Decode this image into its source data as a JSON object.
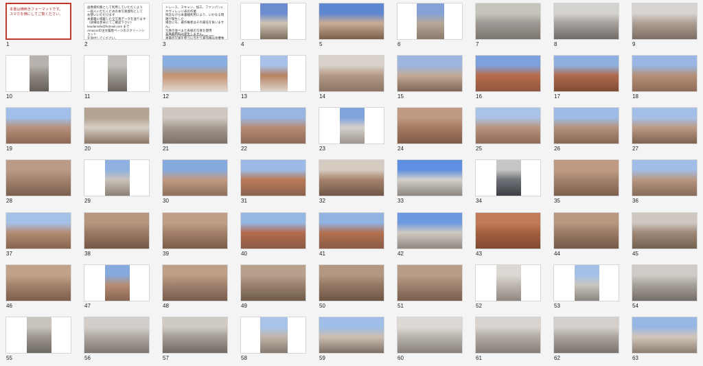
{
  "colors": {
    "background": "#f4f4f4",
    "selection": "#c0392b"
  },
  "pages": [
    {
      "n": "1",
      "kind": "text",
      "text": "本書は横倒きフォーマットです。\nスマホを横にしてご覧ください。"
    },
    {
      "n": "2",
      "kind": "text",
      "text": "画像資料集として利用していただくよう\n一般人いただくための本写真資料として\nお使いいただけます\n本書籍に掲載した全写真データを送ります\n（詳細は巻末にてご確認下さい）\nkaudamafu@hotmail.com まで\nAmazonの注文履歴ページのスクリーンショット\nを添付してください。\n個人撮影の写真ですのでご了承ください。\nTwitterで最新の写真公開"
    },
    {
      "n": "3",
      "kind": "text",
      "text": "トレース、スキャン、加工、ファンパン1\nやヴィレッジ表の作業\n残念ながら本書籍利用により、いかなる問題が発生した\n場合にも、著作権者はその責任を負いません。\n写真の並べまた表紙の写真を使用\n写真使用料は発生しません。\n本書の写真を使うに当たり著作権は放棄致します。\n写真の寿命を延ばすため",
      "footer": "問い合わせ先  kaudamafu@hotmail.com"
    },
    {
      "n": "4",
      "kind": "photo",
      "shape": "portrait2",
      "c": [
        "#6b8ccf",
        "#cfc3b4",
        "#7d6e5f"
      ]
    },
    {
      "n": "5",
      "kind": "photo",
      "shape": "full",
      "c": [
        "#5f86d1",
        "#c9ad95",
        "#7b5d4b"
      ]
    },
    {
      "n": "6",
      "kind": "photo",
      "shape": "portrait2",
      "c": [
        "#84a2d6",
        "#b7a898",
        "#8a7a6c"
      ]
    },
    {
      "n": "7",
      "kind": "photo",
      "shape": "full",
      "c": [
        "#c7c3bd",
        "#9f9a95",
        "#7a746f"
      ]
    },
    {
      "n": "8",
      "kind": "photo",
      "shape": "full",
      "c": [
        "#d4d2cf",
        "#a6a19c",
        "#6f6a65"
      ]
    },
    {
      "n": "9",
      "kind": "photo",
      "shape": "full",
      "c": [
        "#d7d4d1",
        "#ae9f93",
        "#7c6e64"
      ]
    },
    {
      "n": "10",
      "kind": "photo",
      "shape": "portrait3",
      "c": [
        "#b8b3ae",
        "#8f8882",
        "#66605a"
      ]
    },
    {
      "n": "11",
      "kind": "photo",
      "shape": "portrait3",
      "c": [
        "#c3bfbb",
        "#9d9791",
        "#6c655f"
      ]
    },
    {
      "n": "12",
      "kind": "photo",
      "shape": "full",
      "c": [
        "#8aaedf",
        "#c4926f",
        "#e1d7cd"
      ]
    },
    {
      "n": "13",
      "kind": "photo",
      "shape": "portrait2",
      "c": [
        "#a7c1e8",
        "#b88263",
        "#dcd4cb"
      ]
    },
    {
      "n": "14",
      "kind": "photo",
      "shape": "full",
      "c": [
        "#d9d2ca",
        "#b39a87",
        "#8d7464"
      ]
    },
    {
      "n": "15",
      "kind": "photo",
      "shape": "full",
      "c": [
        "#9cb6df",
        "#c2ab98",
        "#7f6656"
      ]
    },
    {
      "n": "16",
      "kind": "photo",
      "shape": "full",
      "c": [
        "#7da1dc",
        "#b86d4a",
        "#8f5840"
      ]
    },
    {
      "n": "17",
      "kind": "photo",
      "shape": "full",
      "c": [
        "#8eb0e0",
        "#b06b4c",
        "#7d4b35"
      ]
    },
    {
      "n": "18",
      "kind": "photo",
      "shape": "full",
      "c": [
        "#97b6e3",
        "#b69077",
        "#8e6b58"
      ]
    },
    {
      "n": "19",
      "kind": "photo",
      "shape": "full",
      "c": [
        "#a1bfe8",
        "#b7917b",
        "#8d6753"
      ]
    },
    {
      "n": "20",
      "kind": "photo",
      "shape": "full",
      "c": [
        "#b4a493",
        "#d6cec6",
        "#8b7564"
      ]
    },
    {
      "n": "21",
      "kind": "photo",
      "shape": "full",
      "c": [
        "#cfc8c1",
        "#a59a91",
        "#7b6f66"
      ]
    },
    {
      "n": "22",
      "kind": "photo",
      "shape": "full",
      "c": [
        "#9ab6e0",
        "#b58b74",
        "#8f6b59"
      ]
    },
    {
      "n": "23",
      "kind": "photo",
      "shape": "portrait",
      "c": [
        "#7fa3db",
        "#d6d1cc",
        "#9d958f"
      ]
    },
    {
      "n": "24",
      "kind": "photo",
      "shape": "full",
      "c": [
        "#c09b82",
        "#a67b62",
        "#7f5c49"
      ]
    },
    {
      "n": "25",
      "kind": "photo",
      "shape": "full",
      "c": [
        "#a9c2e6",
        "#b8937d",
        "#8e6a57"
      ]
    },
    {
      "n": "26",
      "kind": "photo",
      "shape": "full",
      "c": [
        "#9ebce6",
        "#b4917b",
        "#846754"
      ]
    },
    {
      "n": "27",
      "kind": "photo",
      "shape": "full",
      "c": [
        "#a3bfe7",
        "#bd9a84",
        "#7e6250"
      ]
    },
    {
      "n": "28",
      "kind": "photo",
      "shape": "full",
      "c": [
        "#b99b86",
        "#a5836e",
        "#7b604f"
      ]
    },
    {
      "n": "29",
      "kind": "photo",
      "shape": "portrait",
      "c": [
        "#8fb0e1",
        "#cbc3bb",
        "#8b8076"
      ]
    },
    {
      "n": "30",
      "kind": "photo",
      "shape": "full",
      "c": [
        "#86aade",
        "#c29a80",
        "#8c6f5e"
      ]
    },
    {
      "n": "31",
      "kind": "photo",
      "shape": "full",
      "c": [
        "#9bbbe6",
        "#b87a57",
        "#8c6450"
      ]
    },
    {
      "n": "32",
      "kind": "photo",
      "shape": "full",
      "c": [
        "#d5cbc1",
        "#a8826b",
        "#6f5647"
      ]
    },
    {
      "n": "33",
      "kind": "photo",
      "shape": "full",
      "c": [
        "#5f8fe0",
        "#d4cfca",
        "#8c8580"
      ]
    },
    {
      "n": "34",
      "kind": "photo",
      "shape": "portrait",
      "c": [
        "#c7c6c4",
        "#6f7278",
        "#3c3e43"
      ]
    },
    {
      "n": "35",
      "kind": "photo",
      "shape": "full",
      "c": [
        "#bf9b83",
        "#a3826d",
        "#7c5f4d"
      ]
    },
    {
      "n": "36",
      "kind": "photo",
      "shape": "full",
      "c": [
        "#a0bde6",
        "#b99782",
        "#866a58"
      ]
    },
    {
      "n": "37",
      "kind": "photo",
      "shape": "full",
      "c": [
        "#a6c1e8",
        "#b48d75",
        "#86634f"
      ]
    },
    {
      "n": "38",
      "kind": "photo",
      "shape": "full",
      "c": [
        "#b8957e",
        "#9c7964",
        "#735746"
      ]
    },
    {
      "n": "39",
      "kind": "photo",
      "shape": "full",
      "c": [
        "#c19f87",
        "#a3806a",
        "#7a5c4a"
      ]
    },
    {
      "n": "40",
      "kind": "photo",
      "shape": "full",
      "c": [
        "#96b7e4",
        "#b36c4d",
        "#8a5a45"
      ]
    },
    {
      "n": "41",
      "kind": "photo",
      "shape": "full",
      "c": [
        "#92b4e3",
        "#b2704f",
        "#8b5c47"
      ]
    },
    {
      "n": "42",
      "kind": "photo",
      "shape": "full",
      "c": [
        "#6d99e0",
        "#d0c9c2",
        "#908780"
      ]
    },
    {
      "n": "43",
      "kind": "photo",
      "shape": "full",
      "c": [
        "#c27b58",
        "#a4603f",
        "#7f4a32"
      ]
    },
    {
      "n": "44",
      "kind": "photo",
      "shape": "full",
      "c": [
        "#b99780",
        "#9b7a66",
        "#745a49"
      ]
    },
    {
      "n": "45",
      "kind": "photo",
      "shape": "full",
      "c": [
        "#cfc8c0",
        "#a08a79",
        "#73604f"
      ]
    },
    {
      "n": "46",
      "kind": "photo",
      "shape": "full",
      "c": [
        "#c2a189",
        "#a6836d",
        "#7b5e4c"
      ]
    },
    {
      "n": "47",
      "kind": "photo",
      "shape": "portrait",
      "c": [
        "#86aade",
        "#b78d74",
        "#876552"
      ]
    },
    {
      "n": "48",
      "kind": "photo",
      "shape": "full",
      "c": [
        "#bea088",
        "#9f816d",
        "#775e4d"
      ]
    },
    {
      "n": "49",
      "kind": "photo",
      "shape": "full",
      "c": [
        "#b7a08c",
        "#9b836f",
        "#6f5b4b"
      ]
    },
    {
      "n": "50",
      "kind": "photo",
      "shape": "full",
      "c": [
        "#b39781",
        "#967965",
        "#6c5545"
      ]
    },
    {
      "n": "51",
      "kind": "photo",
      "shape": "full",
      "c": [
        "#b99d88",
        "#a18370",
        "#785f4e"
      ]
    },
    {
      "n": "52",
      "kind": "photo",
      "shape": "portrait",
      "c": [
        "#dcd8d3",
        "#bfb8b1",
        "#908780"
      ]
    },
    {
      "n": "53",
      "kind": "photo",
      "shape": "portrait",
      "c": [
        "#a4c0e8",
        "#cbc6c0",
        "#8c857f"
      ]
    },
    {
      "n": "54",
      "kind": "photo",
      "shape": "full",
      "c": [
        "#d0cbc6",
        "#a7a09a",
        "#756e68"
      ]
    },
    {
      "n": "55",
      "kind": "photo",
      "shape": "portrait",
      "c": [
        "#c8c3bd",
        "#9d9690",
        "#6e6862"
      ]
    },
    {
      "n": "56",
      "kind": "photo",
      "shape": "full",
      "c": [
        "#d3cec9",
        "#aea7a1",
        "#7d7670"
      ]
    },
    {
      "n": "57",
      "kind": "photo",
      "shape": "full",
      "c": [
        "#cfcac4",
        "#a49d97",
        "#716a64"
      ]
    },
    {
      "n": "58",
      "kind": "photo",
      "shape": "portrait2",
      "c": [
        "#a9c3e8",
        "#c2b5a8",
        "#857a70"
      ]
    },
    {
      "n": "59",
      "kind": "photo",
      "shape": "full",
      "c": [
        "#9fbde6",
        "#cdbfb1",
        "#7b6f65"
      ]
    },
    {
      "n": "60",
      "kind": "photo",
      "shape": "full",
      "c": [
        "#ddd9d5",
        "#b9b3ad",
        "#88817b"
      ]
    },
    {
      "n": "61",
      "kind": "photo",
      "shape": "full",
      "c": [
        "#d8d3ce",
        "#b1aaa4",
        "#847d77"
      ]
    },
    {
      "n": "62",
      "kind": "photo",
      "shape": "full",
      "c": [
        "#d4cfca",
        "#aba49e",
        "#7a736d"
      ]
    },
    {
      "n": "63",
      "kind": "photo",
      "shape": "full",
      "c": [
        "#96b6e3",
        "#d3c7bb",
        "#8b7d71"
      ]
    }
  ],
  "selected_page": "1"
}
